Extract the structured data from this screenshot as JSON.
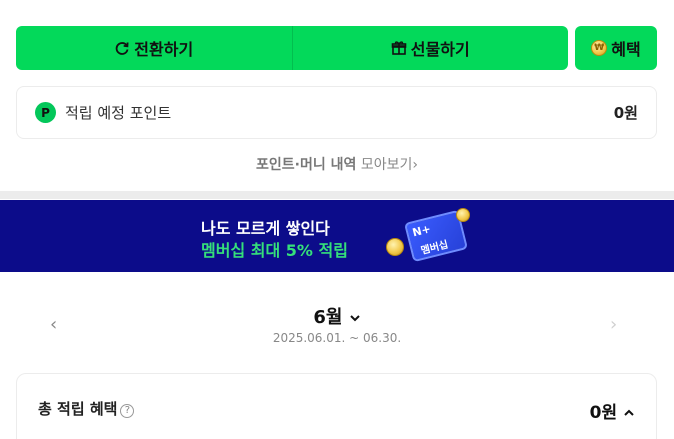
{
  "actions": {
    "convert_label": "전환하기",
    "convert_icon": "refresh-icon",
    "gift_label": "선물하기",
    "gift_icon": "gift-icon",
    "benefit_label": "혜택",
    "benefit_icon": "coin-icon"
  },
  "points": {
    "badge": "P",
    "label": "적립 예정 포인트",
    "value": "0원"
  },
  "history": {
    "strong": "포인트·머니 내역",
    "rest": " 모아보기",
    "chevron": "›"
  },
  "banner": {
    "line1": "나도 모르게 쌓인다",
    "line2": "멤버십 최대 5% 적립",
    "card_np": "N+",
    "card_text": "멤버십"
  },
  "period": {
    "month": "6월",
    "range": "2025.06.01. ~ 06.30.",
    "prev_icon": "chevron-left-icon",
    "next_icon": "chevron-right-icon"
  },
  "total": {
    "label": "총 적립 혜택",
    "help": "?",
    "value": "0원",
    "toggle": "˄"
  },
  "colors": {
    "accent": "#03d95a",
    "banner_bg": "#0c0c8a",
    "banner_highlight": "#35e07a"
  }
}
